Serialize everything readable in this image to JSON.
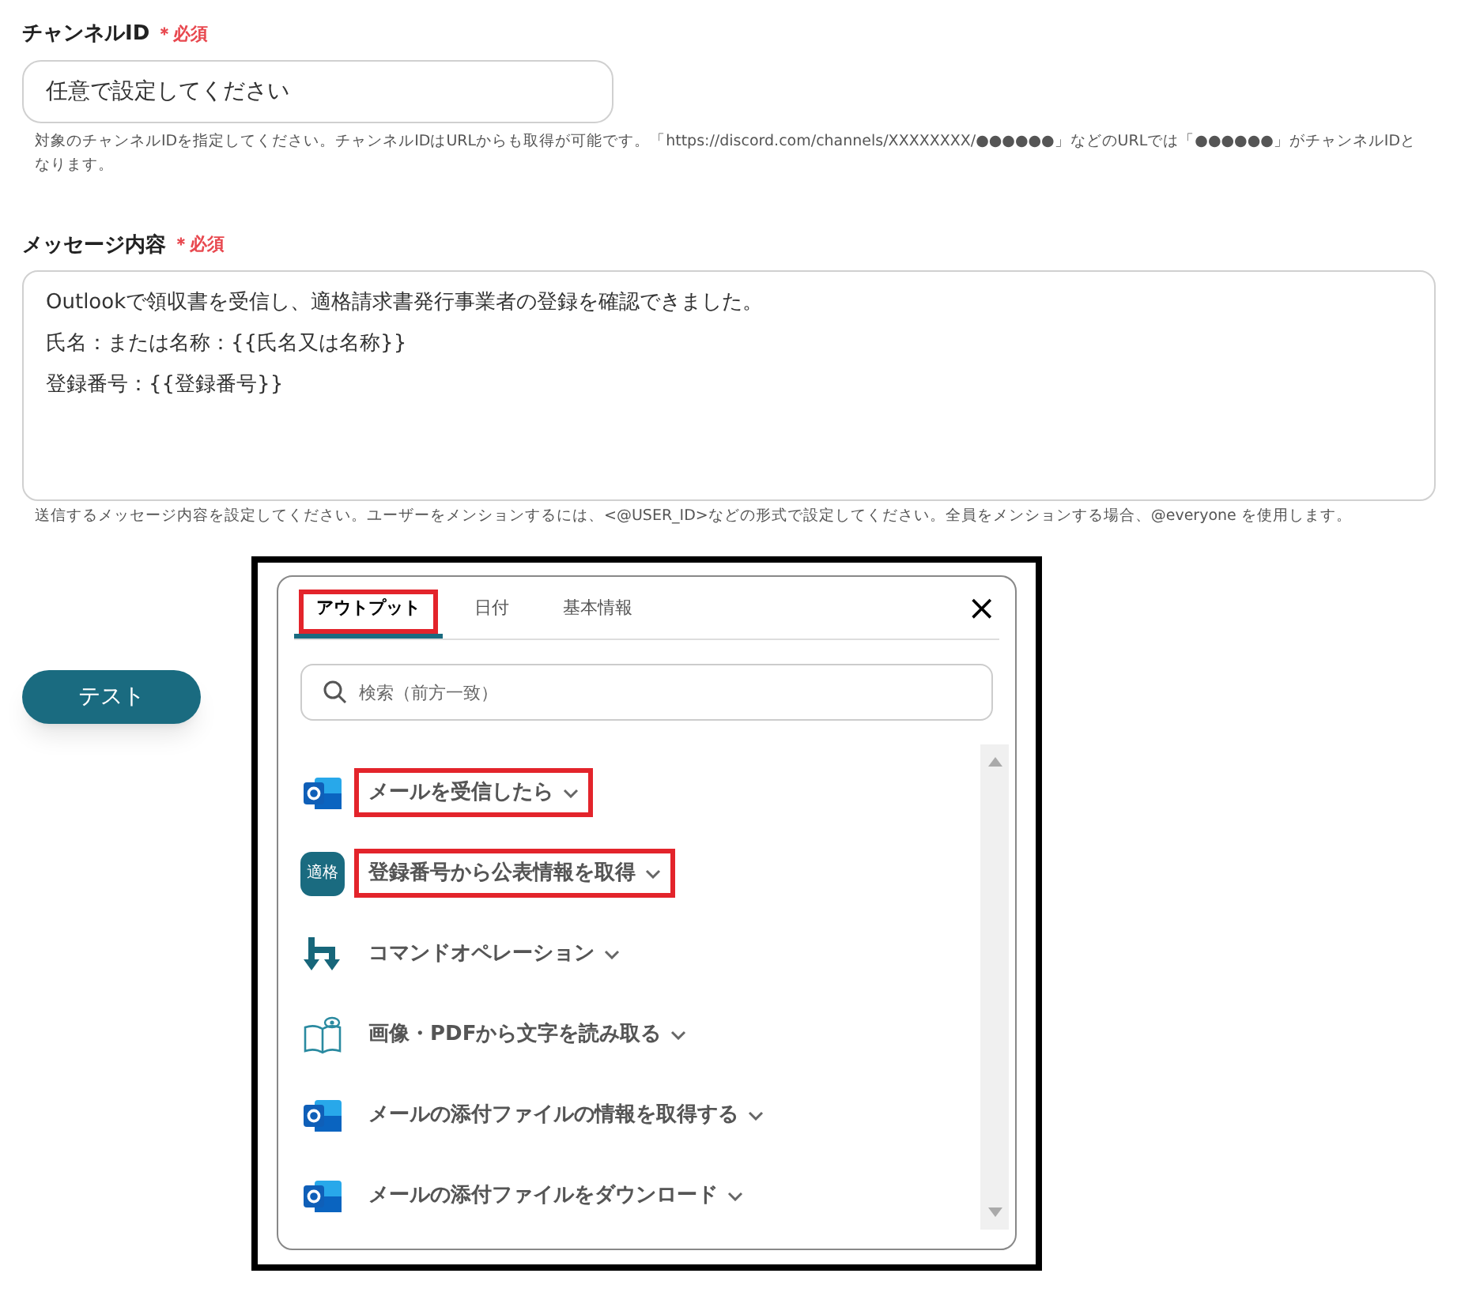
{
  "channel_field": {
    "label": "チャンネルID",
    "required": "＊必須",
    "placeholder": "任意で設定してください",
    "help": "対象のチャンネルIDを指定してください。チャンネルIDはURLからも取得が可能です。「https://discord.com/channels/XXXXXXXX/●●●●●●」などのURLでは「●●●●●●」がチャンネルIDとなります。"
  },
  "message_field": {
    "label": "メッセージ内容",
    "required": "＊必須",
    "lines": [
      "Outlookで領収書を受信し、適格請求書発行事業者の登録を確認できました。",
      "氏名：または名称：{{氏名又は名称}}",
      "登録番号：{{登録番号}}"
    ],
    "help": "送信するメッセージ内容を設定してください。ユーザーをメンションするには、<@USER_ID>などの形式で設定してください。全員をメンションする場合、@everyone を使用します。"
  },
  "test_button": "テスト",
  "popup": {
    "tabs": [
      {
        "label": "アウトプット",
        "selected": true,
        "highlighted": true
      },
      {
        "label": "日付",
        "selected": false,
        "highlighted": false
      },
      {
        "label": "基本情報",
        "selected": false,
        "highlighted": false
      }
    ],
    "close": "×",
    "search": {
      "placeholder": "検索（前方一致）"
    },
    "items": [
      {
        "kind": "outlook",
        "label": "メールを受信したら",
        "highlighted": true
      },
      {
        "kind": "badge",
        "badge": "適格",
        "label": "登録番号から公表情報を取得",
        "highlighted": true
      },
      {
        "kind": "command",
        "label": "コマンドオペレーション",
        "highlighted": false
      },
      {
        "kind": "ocr",
        "label": "画像・PDFから文字を読み取る",
        "highlighted": false
      },
      {
        "kind": "outlook",
        "label": "メールの添付ファイルの情報を取得する",
        "highlighted": false
      },
      {
        "kind": "outlook",
        "label": "メールの添付ファイルをダウンロード",
        "highlighted": false
      }
    ]
  }
}
